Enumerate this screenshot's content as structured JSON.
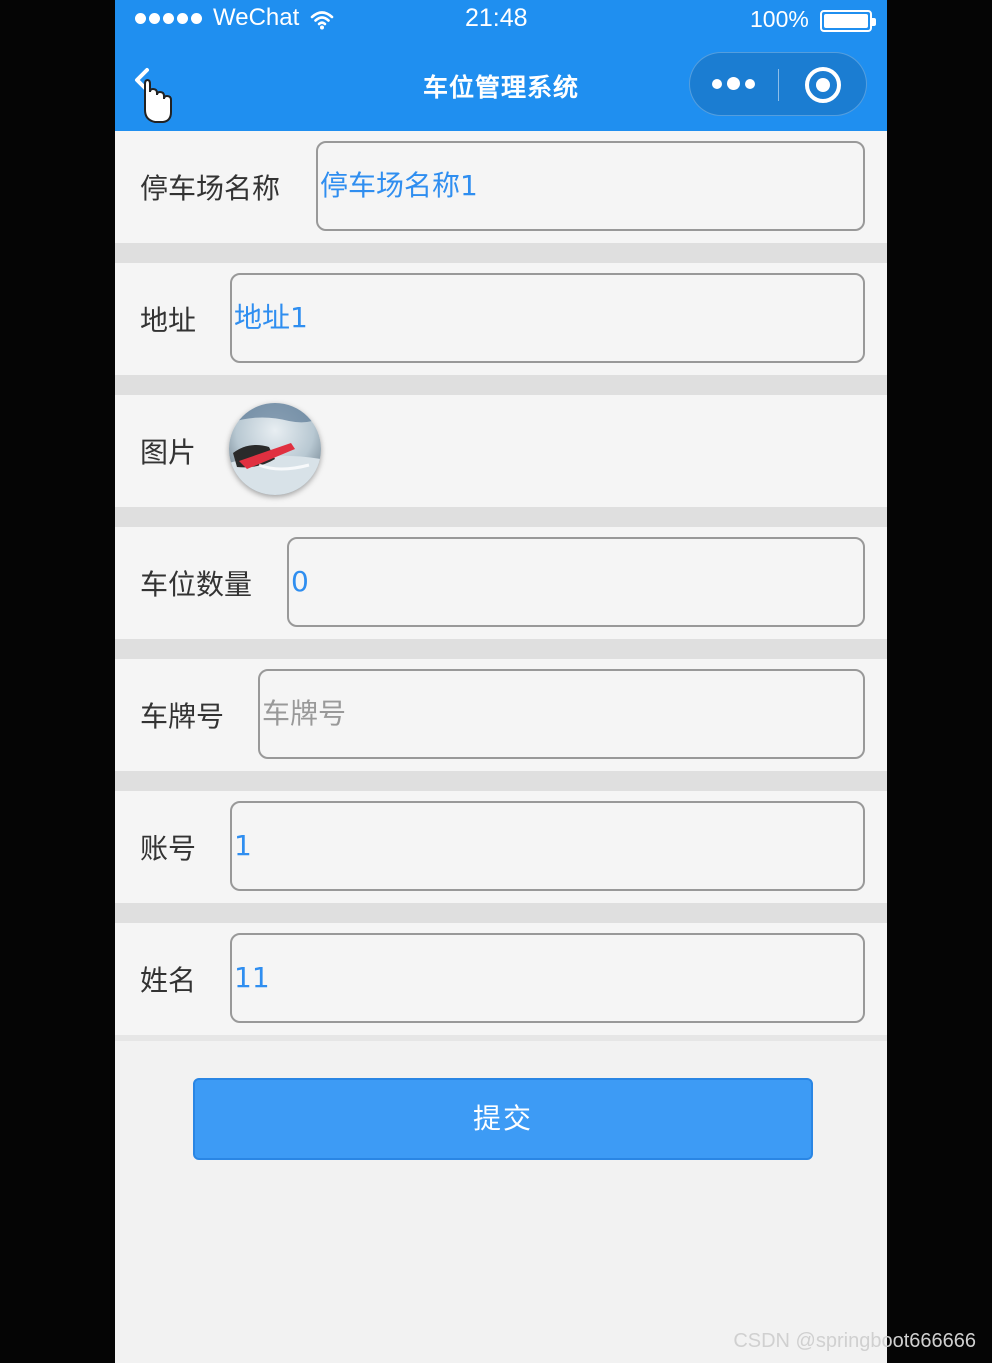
{
  "status_bar": {
    "carrier": "WeChat",
    "time": "21:48",
    "battery": "100%"
  },
  "nav": {
    "title": "车位管理系统"
  },
  "form": {
    "fields": [
      {
        "label": "停车场名称",
        "value": "停车场名称1",
        "placeholder": ""
      },
      {
        "label": "地址",
        "value": "地址1",
        "placeholder": ""
      },
      {
        "label": "图片"
      },
      {
        "label": "车位数量",
        "value": "0",
        "placeholder": ""
      },
      {
        "label": "车牌号",
        "value": "",
        "placeholder": "车牌号"
      },
      {
        "label": "账号",
        "value": "1",
        "placeholder": ""
      },
      {
        "label": "姓名",
        "value": "11",
        "placeholder": ""
      }
    ],
    "submit_label": "提交"
  },
  "watermark": "CSDN @springboot666666",
  "colors": {
    "primary": "#1f8ff0",
    "button": "#3d9bf5",
    "value_text": "#2f8ef0"
  }
}
